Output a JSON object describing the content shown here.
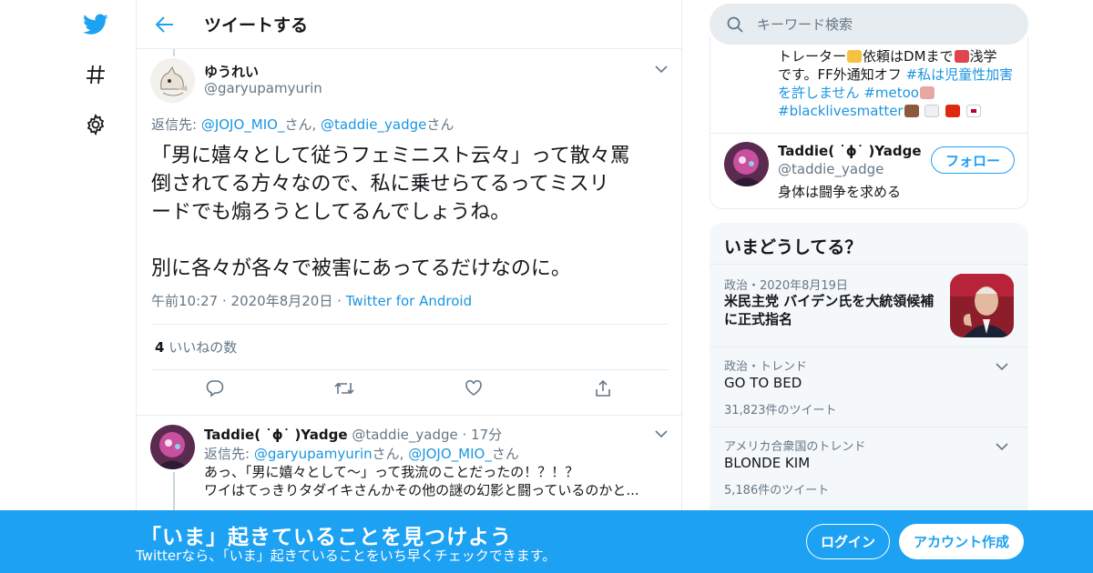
{
  "header": {
    "title": "ツイートする"
  },
  "search": {
    "placeholder": "キーワード検索"
  },
  "tweet": {
    "author_name": "ゆうれい",
    "author_handle": "@garyupamyurin",
    "reply_to_prefix": "返信先: ",
    "reply_to_user1": "@JOJO_MIO_",
    "reply_to_mid": "さん, ",
    "reply_to_user2": "@taddie_yadge",
    "reply_to_suffix": "さん",
    "text": "「男に嬉々として従うフェミニスト云々」って散々罵\n倒されてる方々なので、私に乗せらてるってミスリ\nードでも煽ろうとしてるんでしょうね。\n\n別に各々が各々で被害にあってるだけなのに。",
    "time": "午前10:27",
    "date": "2020年8月20日",
    "source": "Twitter for Android",
    "like_count": "4",
    "like_label": "いいねの数",
    "actions": {
      "reply": "reply-icon",
      "retweet": "retweet-icon",
      "like": "heart-icon",
      "share": "share-icon"
    }
  },
  "reply": {
    "author_name": "Taddie( ˙ϕ˙ )Yadge",
    "author_handle": "@taddie_yadge",
    "time_ago": "17分",
    "reply_to_prefix": "返信先: ",
    "reply_to_user1": "@garyupamyurin",
    "reply_to_mid": "さん, ",
    "reply_to_user2": "@JOJO_MIO_",
    "reply_to_suffix": "さん",
    "text": "あっ、「男に嬉々として〜」って我流のことだったの！？！？\nワイはてっきりタダイキさんかその他の謎の幻影と闘っているのかと..."
  },
  "who_to_follow": {
    "bio_line1": "トレーター",
    "bio_line1b": "依頼はDMまで",
    "bio_line1c": "浅学",
    "bio_line2": "です。FF外通知オフ ",
    "bio_tag1": "#私は児童性加害",
    "bio_line3_tag": "を許しません",
    "bio_tag2": "#metoo",
    "bio_tag3": "#blacklivesmatter",
    "name": "Taddie( ˙ϕ˙ )Yadge",
    "handle": "@taddie_yadge",
    "desc": "身体は闘争を求める",
    "follow_label": "フォロー"
  },
  "trends": {
    "title": "いまどうしてる？",
    "items": [
      {
        "meta": "政治・2020年8月19日",
        "name": "米民主党 バイデン氏を大統領候補\nに正式指名"
      },
      {
        "meta": "政治・トレンド",
        "name": "GO TO BED",
        "count": "31,823件のツイート"
      },
      {
        "meta": "アメリカ合衆国のトレンド",
        "name": "BLONDE KIM",
        "count": "5,186件のツイート"
      }
    ]
  },
  "banner": {
    "title": "「いま」起きていることを見つけよう",
    "subtitle": "Twitterなら、「いま」起きていることをいち早くチェックできます。",
    "login": "ログイン",
    "signup": "アカウント作成"
  },
  "colors": {
    "brand": "#1da1f2",
    "link": "#1b95e0",
    "muted": "#657786"
  }
}
